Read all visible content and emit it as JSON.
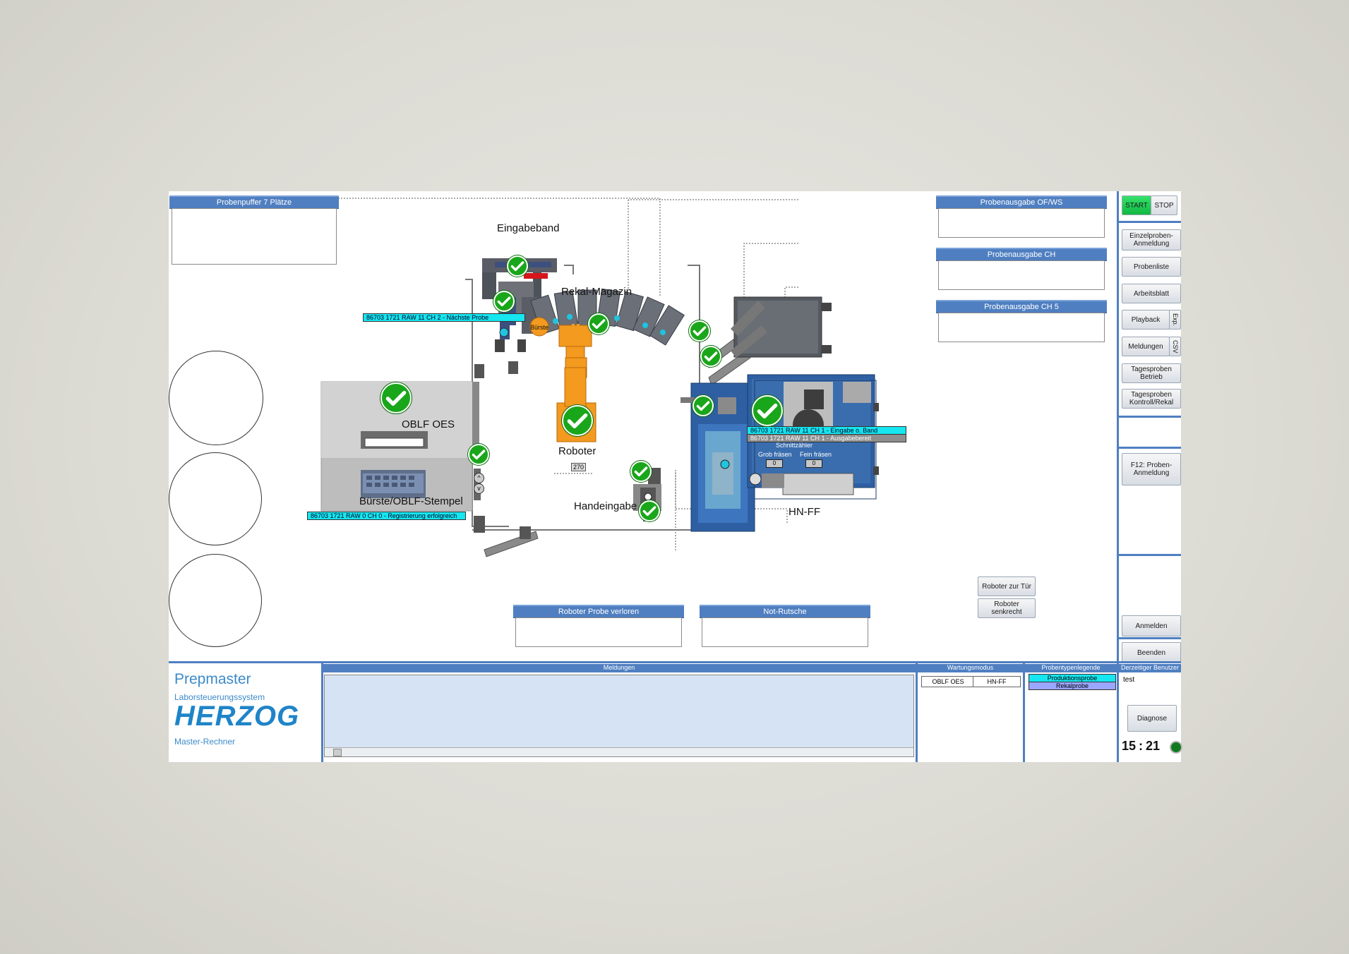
{
  "panels": {
    "probenpuffer": "Probenpuffer 7 Plätze",
    "ausgabe_of_ws": "Probenausgabe OF/WS",
    "ausgabe_ch": "Probenausgabe CH",
    "ausgabe_ch5": "Probenausgabe CH 5",
    "roboter_verloren": "Roboter Probe verloren",
    "not_rutsche": "Not-Rutsche"
  },
  "stations": {
    "eingabeband": "Eingabeband",
    "rekal_magazin": "Rekal-Magazin",
    "oblf_oes": "OBLF OES",
    "roboter": "Roboter",
    "roboter_value": "270",
    "buerste_stempel": "Bürste/OBLF-Stempel",
    "handeingabe": "Handeingabe",
    "hn_ff": "HN-FF",
    "buerste_badge": "Bürste",
    "schnittzaehler": "Schnittzähler",
    "grob_fraesen": "Grob fräsen",
    "fein_fraesen": "Fein fräsen",
    "grob_value": "0",
    "fein_value": "0",
    "arrow_up": "^",
    "arrow_down": "v"
  },
  "tags": {
    "naechste_probe": "86703 1721 RAW 11 CH 2 - Nächste Probe",
    "registrierung": "86703 1721 RAW 0 CH 0 - Registrierung erfolgreich",
    "eingabe_band": "86703 1721 RAW 11 CH 1 - Eingabe o. Band",
    "ausgabebereit": "86703 1721 RAW 11 CH 1 - Ausgabebereit"
  },
  "robot_buttons": {
    "zur_tuer": "Roboter zur Tür",
    "senkrecht": "Roboter senkrecht"
  },
  "sidebar": {
    "start": "START",
    "stop": "STOP",
    "einzelproben": "Einzelproben-Anmeldung",
    "probenliste": "Probenliste",
    "arbeitsblatt": "Arbeitsblatt",
    "playback": "Playback",
    "exp": "Exp.",
    "meldungen": "Meldungen",
    "csv": "CSV",
    "tagesproben_betrieb": "Tagesproben Betrieb",
    "tagesproben_kontroll": "Tagesproben Kontroll/Rekal",
    "f12": "F12: Proben-Anmeldung",
    "anmelden": "Anmelden",
    "beenden": "Beenden"
  },
  "footer": {
    "app_name": "Prepmaster",
    "subtitle": "Laborsteuerungssystem",
    "brand": "HERZOG",
    "computer": "Master-Rechner",
    "meldungen_title": "Meldungen",
    "wartungsmodus_title": "Wartungsmodus",
    "wartung_items": [
      "OBLF OES",
      "HN-FF"
    ],
    "legende_title": "Probentypenlegende",
    "legende_items": [
      "Produktionsprobe",
      "Rekalprobe"
    ],
    "benutzer_title": "Derzeitiger Benutzer",
    "benutzer": "test",
    "diagnose": "Diagnose",
    "clock_hours": "15",
    "clock_sep": ":",
    "clock_minutes": "21"
  },
  "colors": {
    "accent": "#4f7fc1",
    "ok_green": "#1aa61a",
    "tag_cyan": "#15e6f0",
    "robot_orange": "#f39a1f",
    "machine_blue": "#2f5f9e"
  }
}
